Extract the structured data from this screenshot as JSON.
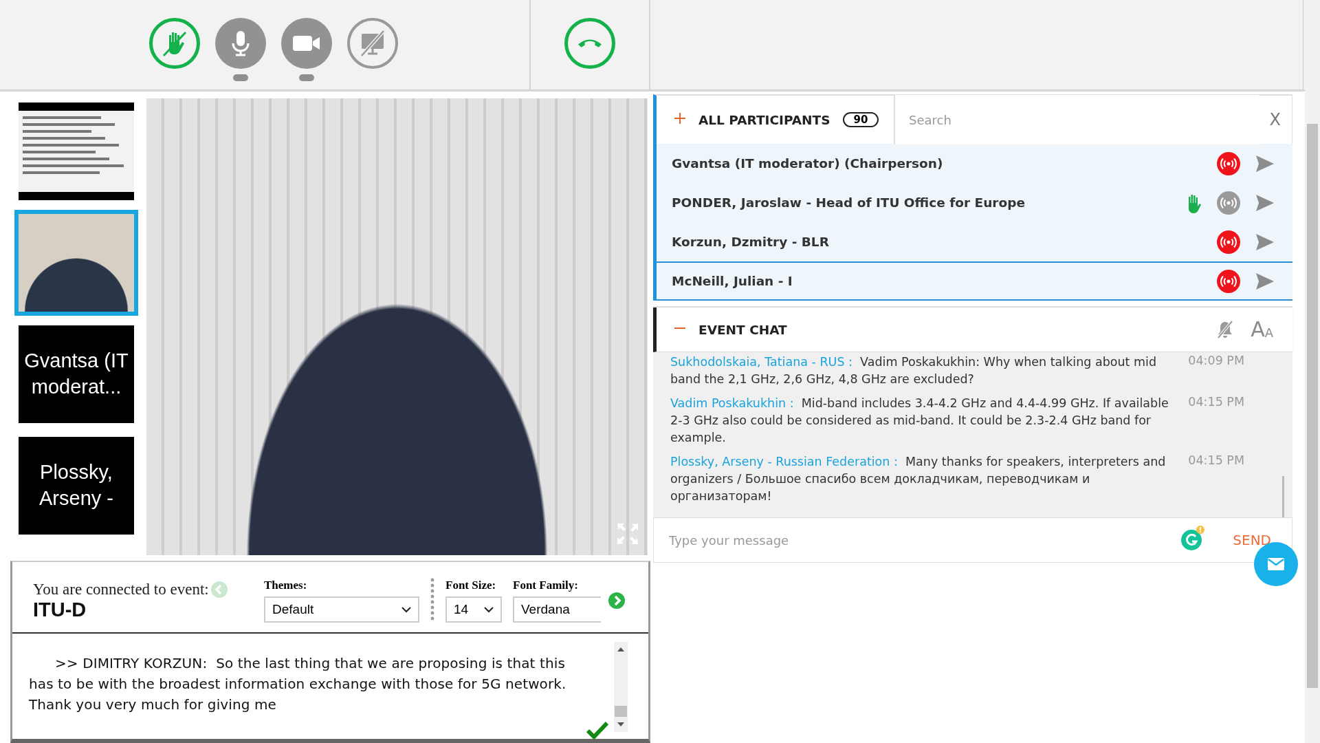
{
  "toolbar": {
    "buttons": [
      {
        "kind": "hand",
        "on": true
      },
      {
        "kind": "mic",
        "on": false
      },
      {
        "kind": "camera",
        "on": false
      },
      {
        "kind": "screen",
        "on": false
      }
    ],
    "hangup": {
      "kind": "hangup"
    }
  },
  "thumbnails": [
    {
      "kind": "slide",
      "selected": false
    },
    {
      "kind": "video",
      "selected": true
    },
    {
      "kind": "name",
      "label": "Gvantsa (IT moderat...",
      "selected": false
    },
    {
      "kind": "name",
      "label": "Plossky, Arseny -",
      "selected": false
    }
  ],
  "participants": {
    "title": "ALL PARTICIPANTS",
    "count": "90",
    "search_placeholder": "Search",
    "close": "X",
    "items": [
      {
        "name": "Gvantsa (IT moderator) (Chairperson)",
        "hand_raised": false,
        "audio_on": true,
        "selected": false
      },
      {
        "name": "PONDER, Jaroslaw - Head of ITU Office for Europe",
        "hand_raised": true,
        "audio_on": false,
        "selected": false
      },
      {
        "name": "Korzun, Dzmitry - BLR",
        "hand_raised": false,
        "audio_on": true,
        "selected": false
      },
      {
        "name": "McNeill, Julian - I",
        "hand_raised": false,
        "audio_on": true,
        "selected": true
      }
    ]
  },
  "chat": {
    "title": "EVENT CHAT",
    "font_button": "AA",
    "placeholder": "Type your message",
    "send": "SEND",
    "messages": [
      {
        "author": "Sukhodolskaia, Tatiana - RUS :",
        "text": "Vadim Poskakukhin: Why when talking about mid band the 2,1 GHz, 2,6 GHz, 4,8 GHz are excluded?",
        "time": "04:09 PM"
      },
      {
        "author": "Vadim Poskakukhin :",
        "text": "Mid-band includes 3.4-4.2 GHz and 4.4-4.99 GHz. If available 2-3 GHz also could be considered as mid-band. It could be 2.3-2.4 GHz band for example.",
        "time": "04:15 PM"
      },
      {
        "author": "Plossky, Arseny - Russian Federation :",
        "text": "Many thanks for speakers, interpreters and organizers / Большое спасибо всем докладчикам, переводчикам и организаторам!",
        "time": "04:15 PM"
      }
    ]
  },
  "captions": {
    "connected_label": "You are connected to event:",
    "event": "ITU-D",
    "themes": {
      "label": "Themes:",
      "value": "Default"
    },
    "font_size": {
      "label": "Font Size:",
      "value": "14"
    },
    "font_family": {
      "label": "Font Family:",
      "value": "Verdana"
    },
    "transcript": ">> DIMITRY KORZUN:  So the last thing that we are proposing is that this has to be with the broadest information exchange with those for 5G network.  Thank you very much for giving me"
  }
}
